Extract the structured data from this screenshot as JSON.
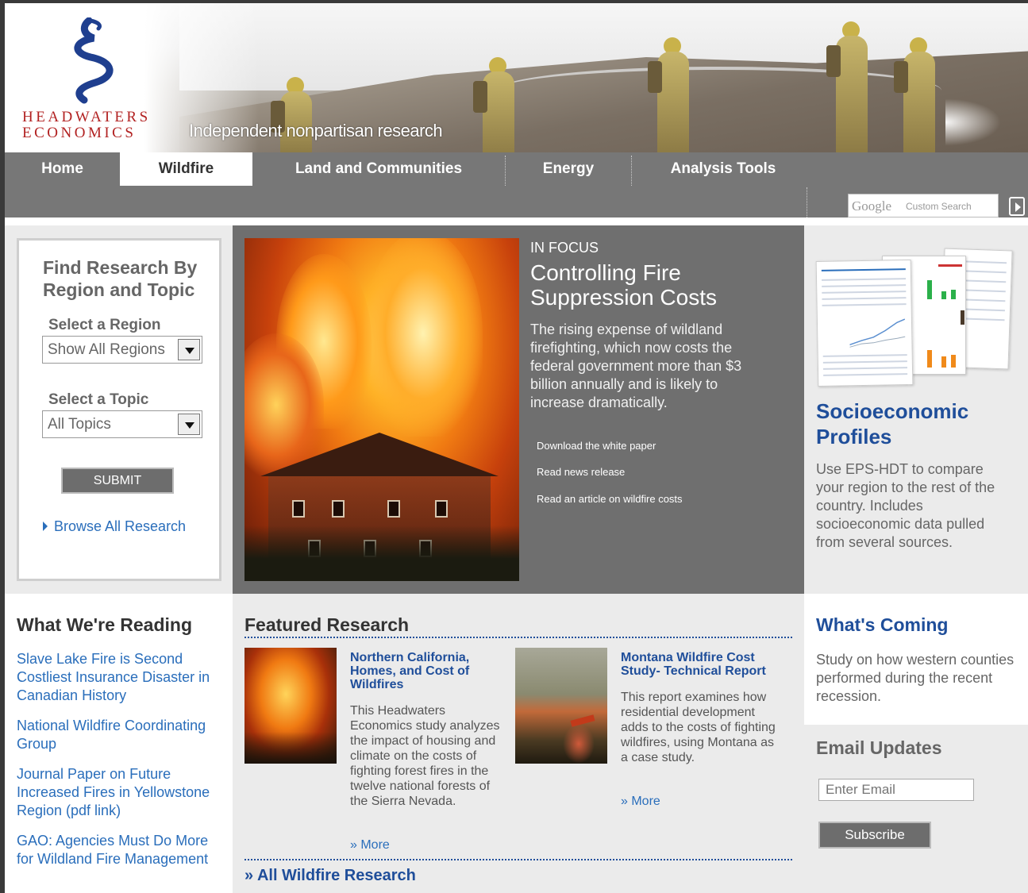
{
  "header": {
    "logo_line1": "HEADWATERS",
    "logo_line2": "ECONOMICS",
    "tagline": "Independent nonpartisan research"
  },
  "nav": {
    "items": [
      {
        "label": "Home"
      },
      {
        "label": "Wildfire",
        "active": true
      },
      {
        "label": "Land and Communities"
      },
      {
        "label": "Energy"
      },
      {
        "label": "Analysis Tools"
      }
    ],
    "search": {
      "brand": "Google",
      "placeholder": "Custom Search"
    }
  },
  "research_finder": {
    "title": "Find Research By Region and Topic",
    "region_label": "Select a Region",
    "region_value": "Show All Regions",
    "topic_label": "Select a Topic",
    "topic_value": "All Topics",
    "submit_label": "SUBMIT",
    "browse_label": "Browse All Research"
  },
  "in_focus": {
    "eyebrow": "IN FOCUS",
    "title": "Controlling Fire Suppression Costs",
    "description": "The rising expense of wildland firefighting, which now costs the federal government more than $3 billion annually and is likely to increase dramatically.",
    "links": [
      "Download the white paper",
      "Read news release",
      "Read an article on wildfire costs"
    ]
  },
  "profiles": {
    "title": "Socioeconomic Profiles",
    "description": "Use EPS-HDT to compare your region to the rest of the country. Includes socioeconomic data pulled from several sources."
  },
  "reading": {
    "title": "What We're Reading",
    "links": [
      "Slave Lake Fire is Second Costliest Insurance Disaster in Canadian History",
      "National Wildfire Coordinating Group",
      "Journal Paper on Future Increased Fires in Yellowstone Region (pdf link)",
      "GAO: Agencies Must Do More for Wildland Fire Management"
    ]
  },
  "featured": {
    "title": "Featured Research",
    "items": [
      {
        "title": "Northern California, Homes, and Cost of Wildfires",
        "description": "This Headwaters Economics study analyzes the impact of housing and climate on the costs of fighting forest fires in the twelve national forests of the Sierra Nevada.",
        "more": "» More"
      },
      {
        "title": "Montana Wildfire Cost Study- Technical Report",
        "description": "This report examines how residential development adds to the costs of fighting wildfires, using Montana as a case study.",
        "more": "» More"
      }
    ],
    "all_link": "» All Wildfire Research"
  },
  "coming": {
    "title": "What's Coming",
    "description": "Study on how western counties performed during the recent recession."
  },
  "email": {
    "title": "Email Updates",
    "placeholder": "Enter Email",
    "button": "Subscribe"
  }
}
